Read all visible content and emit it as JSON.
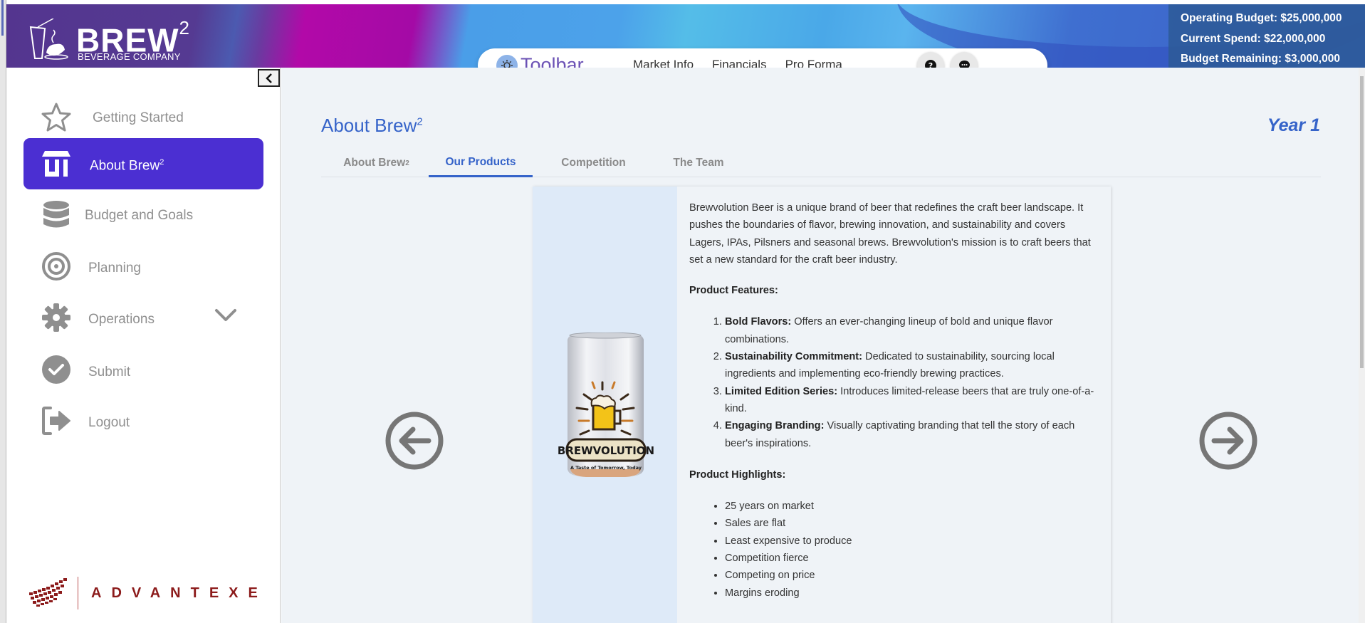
{
  "brand": {
    "name": "BREW",
    "superscript": "2",
    "subtitle": "BEVERAGE COMPANY"
  },
  "budget": {
    "operating": "Operating Budget: $25,000,000",
    "current_spend": "Current Spend: $22,000,000",
    "remaining": "Budget Remaining: $3,000,000"
  },
  "toolbar": {
    "title": "Toolbar",
    "links": [
      "Market Info",
      "Financials",
      "Pro Forma"
    ],
    "help_icon": "question-circle-icon",
    "chat_icon": "chat-bubble-icon"
  },
  "sidebar": {
    "collapse_icon": "chevron-left-icon",
    "items": [
      {
        "label": "Getting Started",
        "icon": "star-icon",
        "active": false
      },
      {
        "label": "About Brew",
        "sup": "2",
        "icon": "store-icon",
        "active": true
      },
      {
        "label": "Budget and Goals",
        "icon": "database-icon",
        "active": false
      },
      {
        "label": "Planning",
        "icon": "target-icon",
        "active": false
      },
      {
        "label": "Operations",
        "icon": "gear-icon",
        "active": false,
        "expandable": true
      },
      {
        "label": "Submit",
        "icon": "check-circle-icon",
        "active": false
      },
      {
        "label": "Logout",
        "icon": "logout-icon",
        "active": false
      }
    ],
    "footer_logo": "ADVANTEXE"
  },
  "page": {
    "title": "About Brew",
    "title_sup": "2",
    "year": "Year 1",
    "tabs": [
      {
        "label": "About Brew",
        "sup": "2",
        "active": false
      },
      {
        "label": "Our Products",
        "active": true
      },
      {
        "label": "Competition",
        "active": false
      },
      {
        "label": "The Team",
        "active": false
      }
    ]
  },
  "product": {
    "image_alt": "Brewvolution beer can",
    "can_brand": "BREWVOLUTION",
    "can_tagline": "A Taste of Tomorrow, Today",
    "description": "Brewvolution Beer is a unique brand of beer that redefines the craft beer landscape. It pushes the boundaries of flavor, brewing innovation, and sustainability and covers Lagers, IPAs, Pilsners and seasonal brews. Brewvolution's mission is to craft beers that set a new standard for the craft beer industry.",
    "features_heading": "Product Features:",
    "features": [
      {
        "title": "Bold Flavors:",
        "text": " Offers an ever-changing lineup of bold and unique flavor combinations."
      },
      {
        "title": "Sustainability Commitment:",
        "text": " Dedicated to sustainability, sourcing local ingredients and implementing eco-friendly brewing practices."
      },
      {
        "title": "Limited Edition Series:",
        "text": " Introduces limited-release beers that are truly one-of-a-kind."
      },
      {
        "title": "Engaging Branding:",
        "text": " Visually captivating branding that tell the story of each beer's inspirations."
      }
    ],
    "highlights_heading": "Product Highlights:",
    "highlights": [
      "25 years on market",
      "Sales are flat",
      "Least expensive to produce",
      "Competition fierce",
      "Competing on price",
      "Margins eroding"
    ]
  },
  "carousel": {
    "prev_icon": "arrow-left-circle-icon",
    "next_icon": "arrow-right-circle-icon"
  },
  "colors": {
    "accent": "#4b2fd2",
    "title_blue": "#3563c9",
    "advantexe_red": "#8c1b1b"
  }
}
